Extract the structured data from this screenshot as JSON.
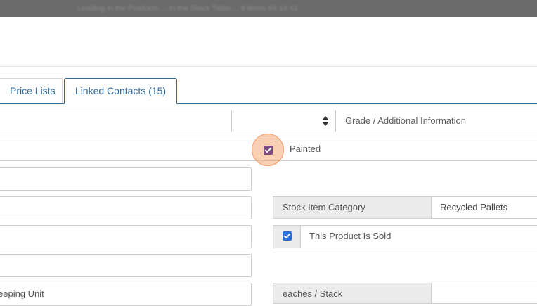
{
  "topbar": {
    "blurred_text": "Loading in the Products ... in the Stock Table ... 6 items 64 14 41"
  },
  "tabs": [
    {
      "label": "Price Lists"
    },
    {
      "label": "Linked Contacts (15)"
    }
  ],
  "form": {
    "grade_placeholder": "Grade / Additional Information",
    "painted_label": "Painted",
    "painted_checked": true,
    "stock_item_category_label": "Stock Item Category",
    "stock_item_category_value": "Recycled Pallets",
    "product_sold_label": "This Product Is Sold",
    "product_sold_checked": true,
    "sku_partial_text": "eeping Unit",
    "eaches_stack_label": "eaches / Stack"
  },
  "colors": {
    "tab_accent": "#2f6b9f",
    "painted_checkbox": "#7a4a82",
    "sold_checkbox": "#2a6fd8",
    "click_highlight": "#f6aa78"
  }
}
